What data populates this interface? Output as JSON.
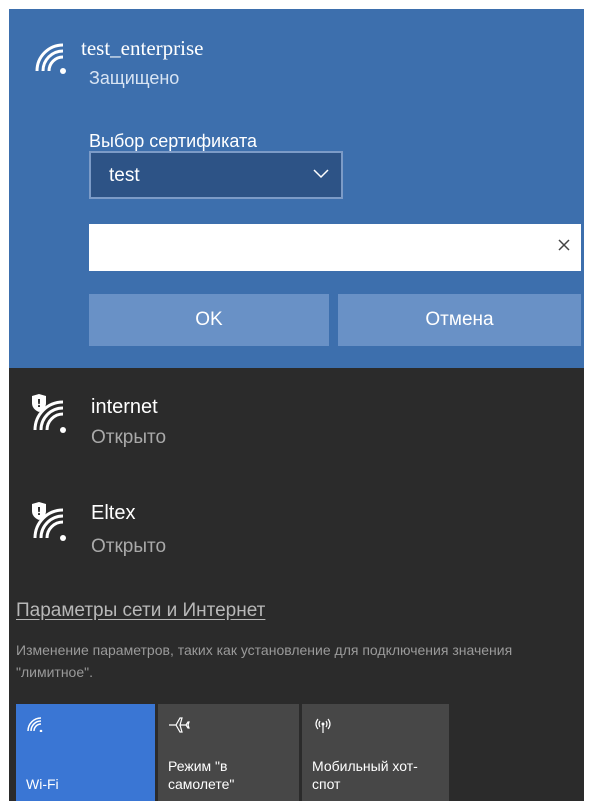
{
  "selected_network": {
    "name": "test_enterprise",
    "status": "Защищено",
    "certificate_label": "Выбор сертификата",
    "certificate_value": "test",
    "input_value": "",
    "ok_label": "OK",
    "cancel_label": "Отмена"
  },
  "networks": [
    {
      "name": "internet",
      "status": "Открыто"
    },
    {
      "name": "Eltex",
      "status": "Открыто"
    }
  ],
  "settings": {
    "link": "Параметры сети и Интернет",
    "description": "Изменение параметров, таких как установление для подключения значения \"лимитное\"."
  },
  "quick_actions": [
    {
      "label": "Wi-Fi",
      "icon": "wifi-icon",
      "active": true
    },
    {
      "label": "Режим \"в самолете\"",
      "icon": "airplane-icon",
      "active": false
    },
    {
      "label": "Мобильный хот-спот",
      "icon": "hotspot-icon",
      "active": false
    }
  ],
  "colors": {
    "selected_bg": "#3d6fad",
    "panel_bg": "#2b2b2b",
    "button_bg": "#6991c6",
    "active_tile": "#3a76d4",
    "tile_bg": "#474747"
  }
}
